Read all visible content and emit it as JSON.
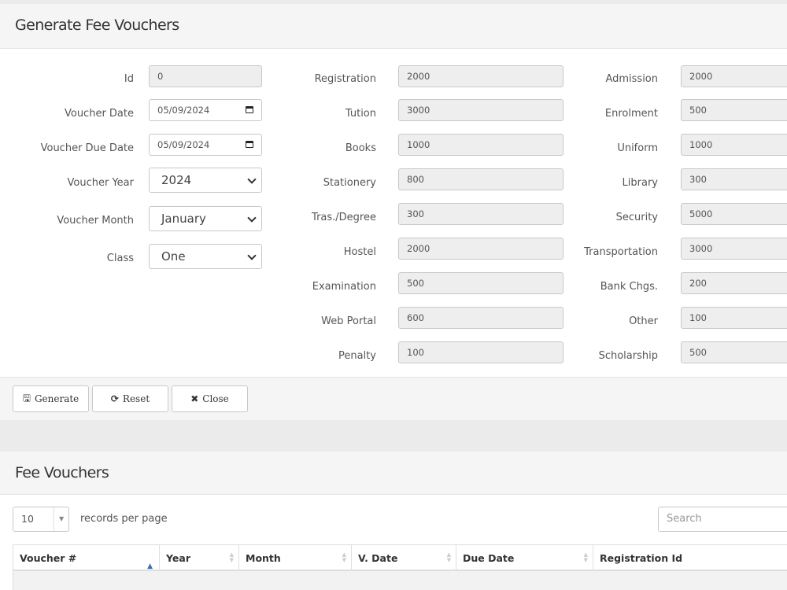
{
  "form": {
    "title": "Generate Fee Vouchers",
    "col1": [
      {
        "label": "Id",
        "value": "0",
        "kind": "readonly"
      },
      {
        "label": "Voucher Date",
        "value": "05/09/2024",
        "kind": "date"
      },
      {
        "label": "Voucher Due Date",
        "value": "05/09/2024",
        "kind": "date"
      },
      {
        "label": "Voucher Year",
        "value": "2024",
        "kind": "select"
      },
      {
        "label": "Voucher Month",
        "value": "January",
        "kind": "select"
      },
      {
        "label": "Class",
        "value": "One",
        "kind": "select"
      }
    ],
    "col2": [
      {
        "label": "Registration",
        "value": "2000"
      },
      {
        "label": "Tution",
        "value": "3000"
      },
      {
        "label": "Books",
        "value": "1000"
      },
      {
        "label": "Stationery",
        "value": "800"
      },
      {
        "label": "Tras./Degree",
        "value": "300"
      },
      {
        "label": "Hostel",
        "value": "2000"
      },
      {
        "label": "Examination",
        "value": "500"
      },
      {
        "label": "Web Portal",
        "value": "600"
      },
      {
        "label": "Penalty",
        "value": "100"
      }
    ],
    "col3": [
      {
        "label": "Admission",
        "value": "2000"
      },
      {
        "label": "Enrolment",
        "value": "500"
      },
      {
        "label": "Uniform",
        "value": "1000"
      },
      {
        "label": "Library",
        "value": "300"
      },
      {
        "label": "Security",
        "value": "5000"
      },
      {
        "label": "Transportation",
        "value": "3000"
      },
      {
        "label": "Bank Chgs.",
        "value": "200"
      },
      {
        "label": "Other",
        "value": "100"
      },
      {
        "label": "Scholarship",
        "value": "500"
      }
    ],
    "buttons": {
      "generate": "Generate",
      "reset": "Reset",
      "close": "Close"
    },
    "icons": {
      "generate": "save-icon",
      "reset": "refresh-icon",
      "close": "close-icon"
    }
  },
  "list": {
    "title": "Fee Vouchers",
    "page_size": "10",
    "records_label": "records per page",
    "search_placeholder": "Search",
    "columns": [
      "Voucher #",
      "Year",
      "Month",
      "V. Date",
      "Due Date",
      "Registration Id"
    ]
  },
  "colors": {
    "header_bg": "#f5f5f5",
    "readonly_bg": "#eeeeee",
    "sort_active": "#3a6fb0"
  }
}
